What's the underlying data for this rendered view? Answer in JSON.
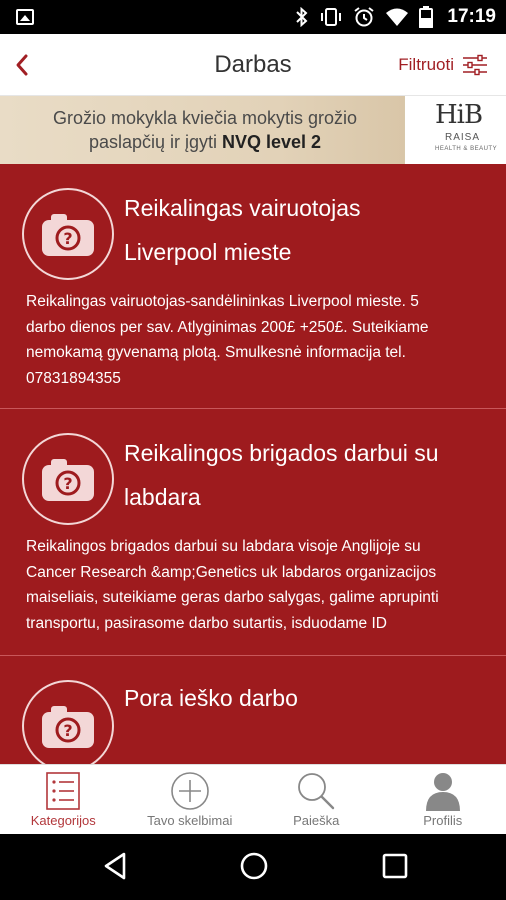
{
  "status_bar": {
    "time": "17:19",
    "icons": [
      "image-icon",
      "bluetooth-icon",
      "vibrate-icon",
      "alarm-icon",
      "wifi-icon",
      "battery-icon"
    ]
  },
  "app_bar": {
    "title": "Darbas",
    "filter_label": "Filtruoti"
  },
  "banner": {
    "line1": "Grožio mokykla kviečia mokytis grožio",
    "line2_prefix": "paslapčių ir įgyti ",
    "line2_bold": "NVQ level 2",
    "logo_mark": "HiB",
    "logo_name": "RAISA",
    "logo_sub": "HEALTH & BEAUTY"
  },
  "listings": [
    {
      "title_line1": "Reikalingas vairuotojas",
      "title_line2": "Liverpool mieste",
      "desc_lines": [
        "Reikalingas vairuotojas-sandėlininkas Liverpool mieste. 5",
        "darbo dienos per sav. Atlyginimas 200£ +250£. Suteikiame",
        "nemokamą gyvenamą plotą. Smulkesnė informacija tel.",
        "07831894355"
      ]
    },
    {
      "title_line1": "Reikalingos brigados darbui su",
      "title_line2": "labdara",
      "desc_lines": [
        "Reikalingos brigados darbui su labdara visoje Anglijoje su",
        "Cancer Research &amp;Genetics uk labdaros organizacijos",
        "maiseliais, suteikiame geras darbo salygas, galime aprupinti",
        "transportu, pasirasome darbo sutartis, isduodame ID"
      ]
    },
    {
      "title_line1": "Pora ieško darbo",
      "title_line2": "",
      "desc_lines": []
    }
  ],
  "tabs": [
    {
      "label": "Kategorijos",
      "icon": "list-icon",
      "active": true
    },
    {
      "label": "Tavo skelbimai",
      "icon": "plus-circle-icon",
      "active": false
    },
    {
      "label": "Paieška",
      "icon": "search-icon",
      "active": false
    },
    {
      "label": "Profilis",
      "icon": "person-icon",
      "active": false
    }
  ],
  "colors": {
    "accent": "#a11f24",
    "feed_background": "#9e1b1e",
    "active_tab": "#b2373b"
  }
}
